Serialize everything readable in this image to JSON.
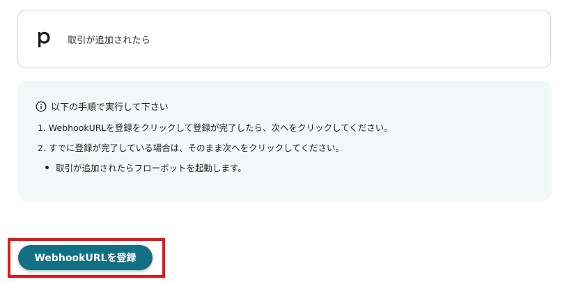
{
  "trigger": {
    "app_icon": "pipedrive-p-logo",
    "label": "取引が追加されたら"
  },
  "instructions": {
    "icon": "info-circle-icon",
    "header": "以下の手順で実行して下さい",
    "step1": "1. WebhookURLを登録をクリックして登録が完了したら、次へをクリックしてください。",
    "step2": "2. すでに登録が完了している場合は、そのまま次へをクリックしてください。",
    "bullet": "取引が追加されたらフローボットを起動します。"
  },
  "register_button": {
    "label": "WebhookURLを登録",
    "color": "#136f83"
  },
  "highlight_color": "#e0191c"
}
